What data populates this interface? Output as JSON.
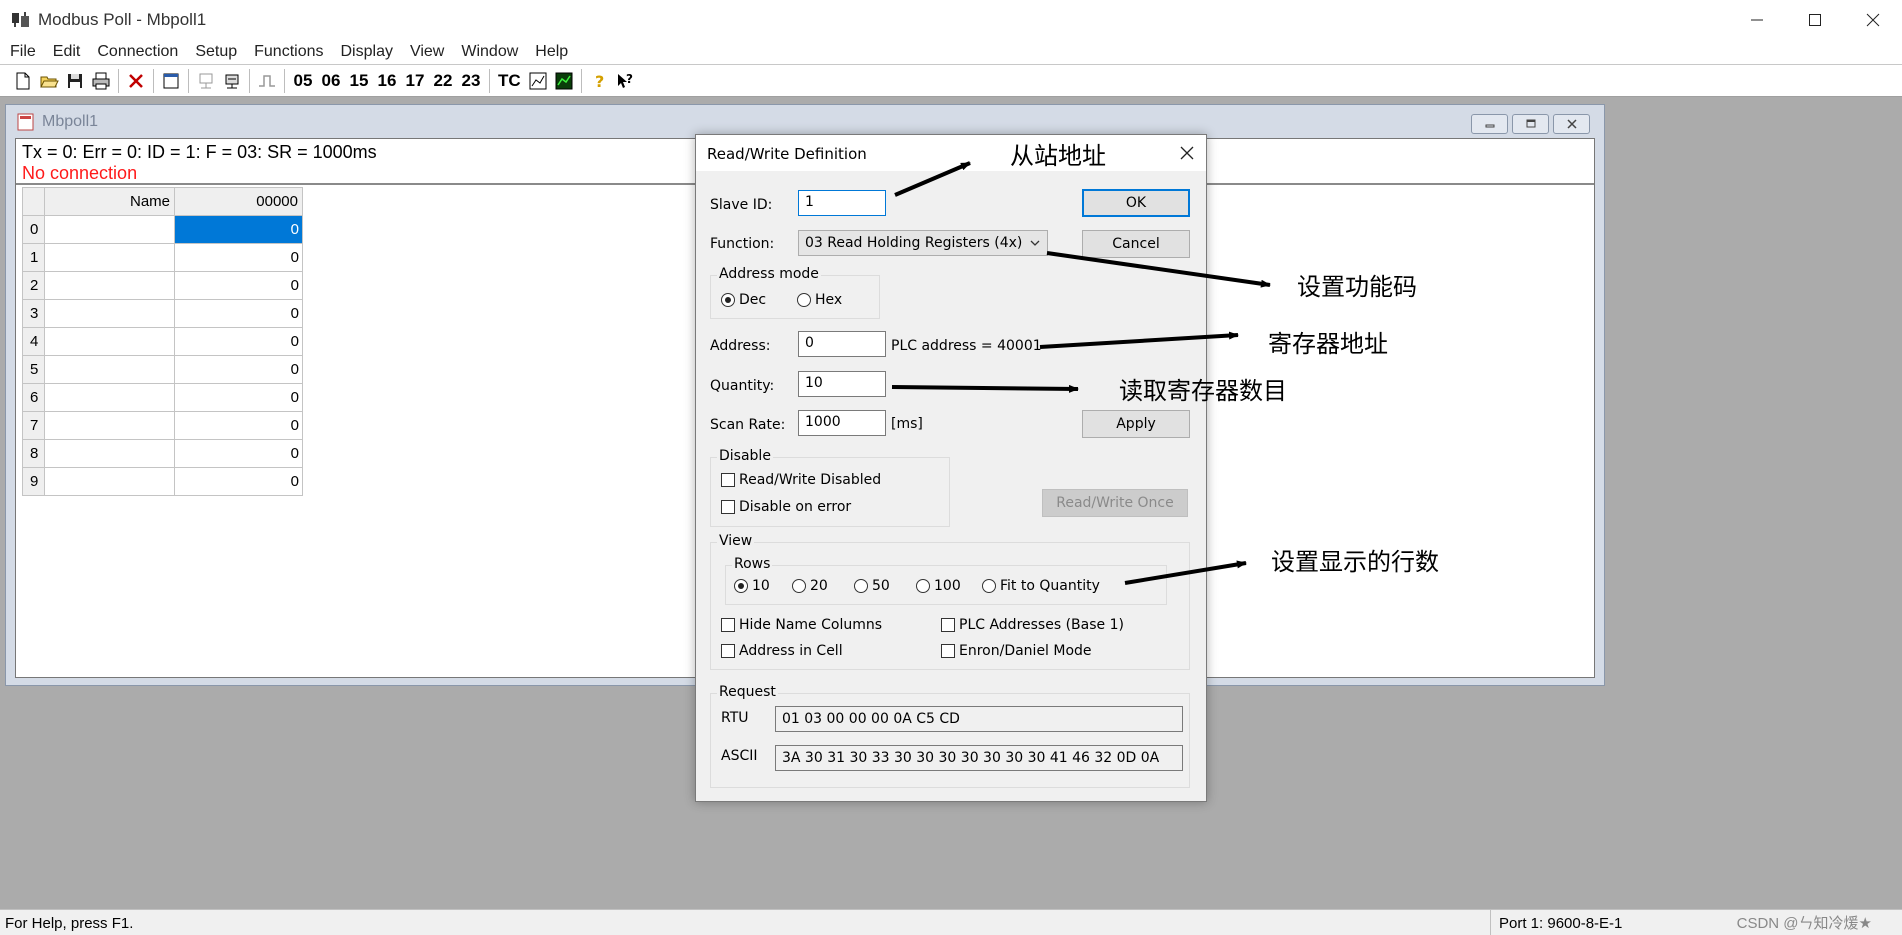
{
  "app": {
    "title": "Modbus Poll - Mbpoll1"
  },
  "menu": [
    "File",
    "Edit",
    "Connection",
    "Setup",
    "Functions",
    "Display",
    "View",
    "Window",
    "Help"
  ],
  "toolbar": {
    "function_codes": [
      "05",
      "06",
      "15",
      "16",
      "17",
      "22",
      "23"
    ],
    "tc_label": "TC"
  },
  "child_window": {
    "title": "Mbpoll1",
    "status_line": "Tx = 0: Err = 0: ID = 1: F = 03: SR = 1000ms",
    "connection_status": "No connection",
    "connection_status_color": "#ff1a1a",
    "grid": {
      "name_header": "Name",
      "value_header": "00000",
      "rows": [
        {
          "index": "0",
          "name": "",
          "value": "0"
        },
        {
          "index": "1",
          "name": "",
          "value": "0"
        },
        {
          "index": "2",
          "name": "",
          "value": "0"
        },
        {
          "index": "3",
          "name": "",
          "value": "0"
        },
        {
          "index": "4",
          "name": "",
          "value": "0"
        },
        {
          "index": "5",
          "name": "",
          "value": "0"
        },
        {
          "index": "6",
          "name": "",
          "value": "0"
        },
        {
          "index": "7",
          "name": "",
          "value": "0"
        },
        {
          "index": "8",
          "name": "",
          "value": "0"
        },
        {
          "index": "9",
          "name": "",
          "value": "0"
        }
      ]
    }
  },
  "dialog": {
    "title": "Read/Write Definition",
    "slave_id_label": "Slave ID:",
    "slave_id_value": "1",
    "function_label": "Function:",
    "function_value": "03 Read Holding Registers (4x)",
    "address_mode_title": "Address mode",
    "address_mode_dec": "Dec",
    "address_mode_hex": "Hex",
    "address_label": "Address:",
    "address_value": "0",
    "plc_address_text": "PLC address = 40001",
    "quantity_label": "Quantity:",
    "quantity_value": "10",
    "scan_rate_label": "Scan Rate:",
    "scan_rate_value": "1000",
    "scan_rate_unit": "[ms]",
    "ok_label": "OK",
    "cancel_label": "Cancel",
    "apply_label": "Apply",
    "disable_title": "Disable",
    "rw_disabled_label": "Read/Write Disabled",
    "disable_on_error_label": "Disable on error",
    "rw_once_label": "Read/Write Once",
    "view_title": "View",
    "rows_title": "Rows",
    "rows_options": [
      "10",
      "20",
      "50",
      "100",
      "Fit to Quantity"
    ],
    "hide_name_columns_label": "Hide Name Columns",
    "plc_addresses_label": "PLC Addresses (Base 1)",
    "address_in_cell_label": "Address in Cell",
    "enron_label": "Enron/Daniel Mode",
    "request_title": "Request",
    "rtu_label": "RTU",
    "rtu_value": "01 03 00 00 00 0A C5 CD",
    "ascii_label": "ASCII",
    "ascii_value": "3A 30 31 30 33 30 30 30 30 30 30 30 41 46 32 0D 0A"
  },
  "annotations": {
    "slave_address": "从站地址",
    "function_code": "设置功能码",
    "register_address": "寄存器地址",
    "register_count": "读取寄存器数目",
    "display_rows": "设置显示的行数"
  },
  "statusbar": {
    "help_text": "For Help, press F1.",
    "port_text": "Port 1: 9600-8-E-1",
    "watermark": "CSDN @ㄣ知冷煖★"
  }
}
